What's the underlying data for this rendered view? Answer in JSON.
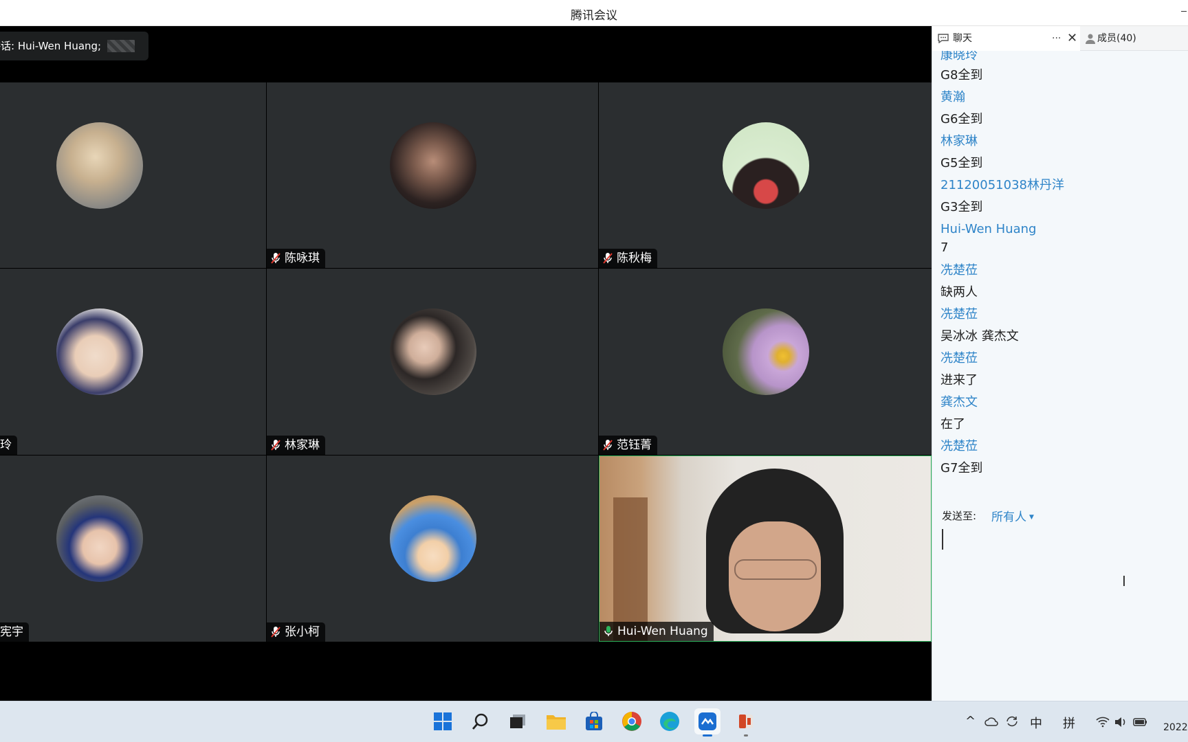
{
  "window": {
    "title": "腾讯会议"
  },
  "speaking": {
    "label": "讲话: Hui-Wen Huang;"
  },
  "tiles": [
    {
      "name": "",
      "mic": "muted"
    },
    {
      "name": "陈咏琪",
      "mic": "muted"
    },
    {
      "name": "陈秋梅",
      "mic": "muted"
    },
    {
      "name": "玲",
      "mic": "none"
    },
    {
      "name": "林家琳",
      "mic": "muted"
    },
    {
      "name": "范钰菁",
      "mic": "muted"
    },
    {
      "name": "宪宇",
      "mic": "none"
    },
    {
      "name": "张小柯",
      "mic": "muted"
    },
    {
      "name": "Hui-Wen Huang",
      "mic": "active"
    }
  ],
  "chat": {
    "tab_label": "聊天",
    "more_label": "···",
    "close_label": "✕",
    "members_label": "成员(40)",
    "messages": [
      {
        "sender": "康晓玲",
        "text": "G8全到"
      },
      {
        "sender": "黄瀚",
        "text": "G6全到"
      },
      {
        "sender": "林家琳",
        "text": "G5全到"
      },
      {
        "sender": "21120051038林丹洋",
        "text": "G3全到"
      },
      {
        "sender": "Hui-Wen Huang",
        "text": "7"
      },
      {
        "sender": "冼楚莅",
        "text": "缺两人"
      },
      {
        "sender": "冼楚莅",
        "text": "吴冰冰 龚杰文"
      },
      {
        "sender": "冼楚莅",
        "text": "进来了"
      },
      {
        "sender": "龚杰文",
        "text": "在了"
      },
      {
        "sender": "冼楚莅",
        "text": "G7全到"
      }
    ],
    "send_to_label": "发送至:",
    "send_to_value": "所有人",
    "input_value": ""
  },
  "taskbar": {
    "tray": {
      "ime_mode": "中",
      "ime_method": "拼"
    },
    "clock": "2022"
  },
  "colors": {
    "accent": "#2e84c8",
    "tile_bg": "#2b2e30",
    "active_border": "#2cb35b"
  }
}
